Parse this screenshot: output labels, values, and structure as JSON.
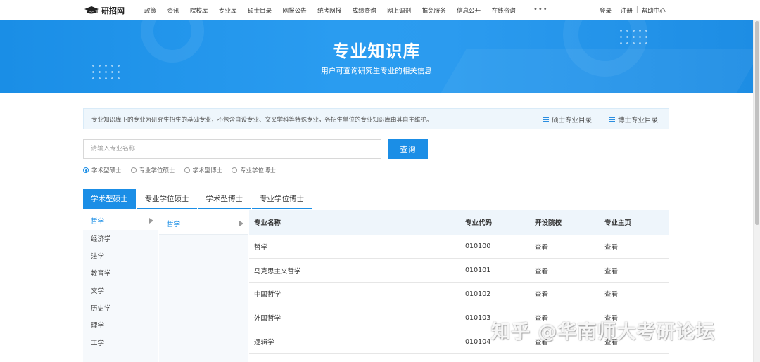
{
  "topnav": {
    "logo_text": "研招网",
    "links": [
      "政策",
      "资讯",
      "院校库",
      "专业库",
      "硕士目录",
      "网报公告",
      "统考网报",
      "成绩查询",
      "网上调剂",
      "推免服务",
      "信息公开",
      "在线咨询"
    ],
    "more": "•••",
    "login": "登录",
    "register": "注册",
    "help": "帮助中心",
    "separator": "|"
  },
  "banner": {
    "title": "专业知识库",
    "subtitle": "用户可查询研究生专业的相关信息"
  },
  "notice": {
    "text": "专业知识库下的专业为研究生招生的基础专业，不包含自设专业、交叉学科等特殊专业，各招生单位的专业知识库由其自主维护。",
    "master_catalog": "硕士专业目录",
    "doctor_catalog": "博士专业目录"
  },
  "search": {
    "placeholder": "请输入专业名称",
    "button": "查询"
  },
  "radios": [
    {
      "label": "学术型硕士",
      "checked": true
    },
    {
      "label": "专业学位硕士",
      "checked": false
    },
    {
      "label": "学术型博士",
      "checked": false
    },
    {
      "label": "专业学位博士",
      "checked": false
    }
  ],
  "tabs": [
    "学术型硕士",
    "专业学位硕士",
    "学术型博士",
    "专业学位博士"
  ],
  "categories": [
    "哲学",
    "经济学",
    "法学",
    "教育学",
    "文学",
    "历史学",
    "理学",
    "工学"
  ],
  "subcategories": [
    "哲学"
  ],
  "table": {
    "headers": [
      "专业名称",
      "专业代码",
      "开设院校",
      "专业主页"
    ],
    "rows": [
      [
        "哲学",
        "010100",
        "查看",
        "查看"
      ],
      [
        "马克思主义哲学",
        "010101",
        "查看",
        "查看"
      ],
      [
        "中国哲学",
        "010102",
        "查看",
        "查看"
      ],
      [
        "外国哲学",
        "010103",
        "查看",
        "查看"
      ],
      [
        "逻辑学",
        "010104",
        "查看",
        "查看"
      ]
    ]
  },
  "watermark": "知乎 @华南师大考研论坛",
  "colors": {
    "accent": "#1b8ee6",
    "banner": "#2a9cf0"
  }
}
